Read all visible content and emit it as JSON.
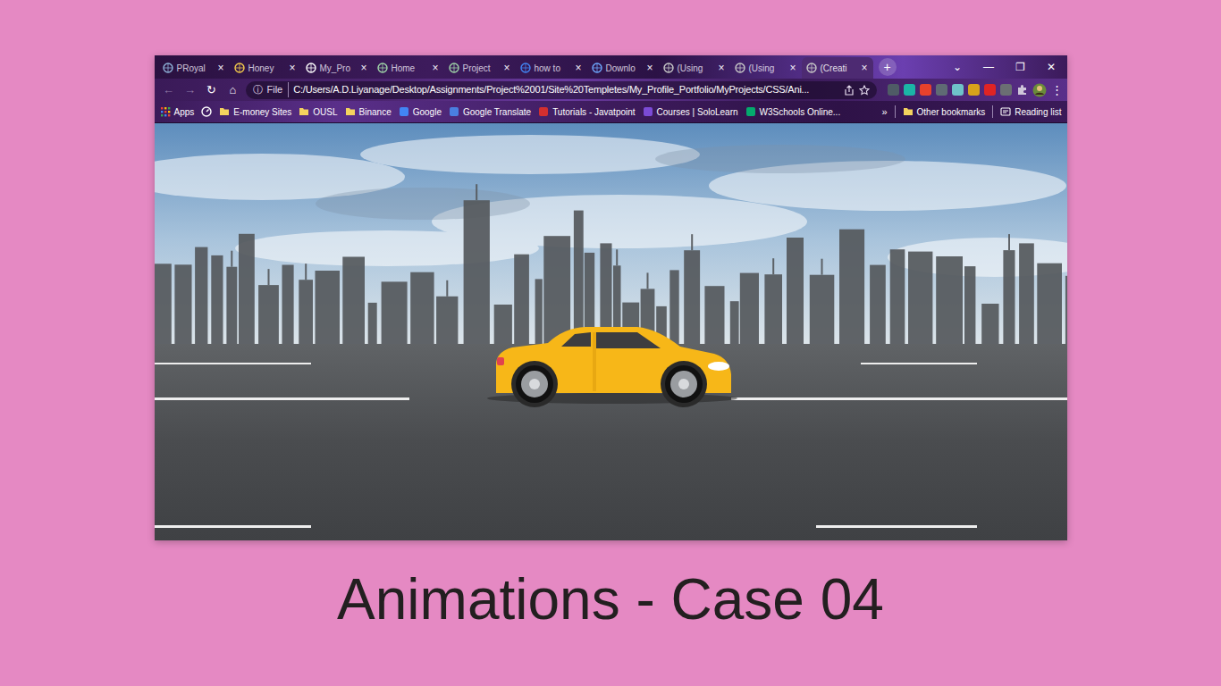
{
  "window": {
    "controls": [
      "⌄",
      "—",
      "❐",
      "✕"
    ]
  },
  "tabs": [
    {
      "label": "PRoyal",
      "selected": false,
      "close": "×"
    },
    {
      "label": "Honey",
      "selected": false,
      "close": "×"
    },
    {
      "label": "My_Pro",
      "selected": false,
      "close": "×"
    },
    {
      "label": "Home",
      "selected": false,
      "close": "×"
    },
    {
      "label": "Project",
      "selected": false,
      "close": "×"
    },
    {
      "label": "how to",
      "selected": false,
      "close": "×"
    },
    {
      "label": "Downlo",
      "selected": false,
      "close": "×"
    },
    {
      "label": "(Using",
      "selected": false,
      "close": "×"
    },
    {
      "label": "(Using",
      "selected": false,
      "close": "×"
    },
    {
      "label": "(Creati",
      "selected": true,
      "close": "×"
    }
  ],
  "new_tab": "+",
  "toolbar": {
    "nav": [
      {
        "glyph": "←",
        "disabled": true
      },
      {
        "glyph": "→",
        "disabled": true
      },
      {
        "glyph": "↻",
        "disabled": false
      },
      {
        "glyph": "⌂",
        "disabled": false
      }
    ],
    "info": "ⓘ",
    "scheme": "File",
    "address": "C:/Users/A.D.Liyanage/Desktop/Assignments/Project%2001/Site%20Templetes/My_Profile_Portfolio/MyProjects/CSS/Ani...",
    "menu": "⋮"
  },
  "bookmarks": {
    "items": [
      {
        "kind": "apps",
        "label": "Apps"
      },
      {
        "kind": "shortcut"
      },
      {
        "kind": "folder",
        "label": "E-money Sites"
      },
      {
        "kind": "folder",
        "label": "OUSL"
      },
      {
        "kind": "folder",
        "label": "Binance"
      },
      {
        "kind": "site",
        "label": "Google",
        "color": "#4285f4"
      },
      {
        "kind": "site",
        "label": "Google Translate",
        "color": "#4a7fe0"
      },
      {
        "kind": "site",
        "label": "Tutorials - Javatpoint",
        "color": "#d32f2f"
      },
      {
        "kind": "site",
        "label": "Courses | SoloLearn",
        "color": "#7b4bd6"
      },
      {
        "kind": "site",
        "label": "W3Schools Online...",
        "color": "#04aa6d"
      }
    ],
    "more": "»",
    "other": "Other bookmarks",
    "reading_list": "Reading list"
  },
  "caption": "Animations - Case 04"
}
